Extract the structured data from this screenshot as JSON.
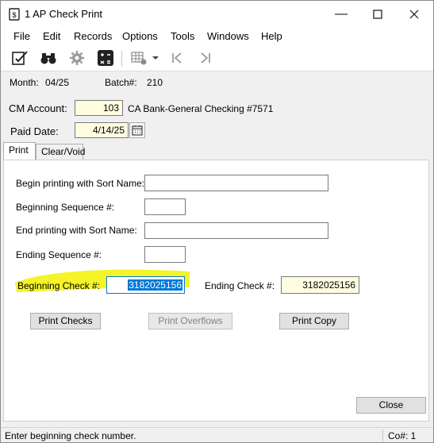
{
  "window": {
    "title": "1 AP Check Print"
  },
  "menu": [
    "File",
    "Edit",
    "Records",
    "Options",
    "Tools",
    "Windows",
    "Help"
  ],
  "toolbar": {
    "icons": [
      "edit-check-icon",
      "binoculars-icon",
      "gear-icon",
      "calculator-icon",
      "grid-settings-icon",
      "chevron-down-icon",
      "first-record-icon",
      "last-record-icon"
    ]
  },
  "header": {
    "month_label": "Month:",
    "month_value": "04/25",
    "batch_label": "Batch#:",
    "batch_value": "210"
  },
  "cm_account": {
    "label": "CM Account:",
    "value": "103",
    "description": "CA Bank-General Checking #7571"
  },
  "paid_date": {
    "label": "Paid Date:",
    "value": "4/14/25"
  },
  "tabs": [
    "Print",
    "Clear/Void"
  ],
  "form": {
    "begin_sort_label": "Begin printing with Sort Name:",
    "begin_seq_label": "Beginning Sequence #:",
    "end_sort_label": "End printing with Sort Name:",
    "end_seq_label": "Ending Sequence #:",
    "begin_check_label": "Beginning Check #:",
    "begin_check_value": "3182025156",
    "end_check_label": "Ending Check #:",
    "end_check_value": "3182025156"
  },
  "buttons": {
    "print_checks": "Print Checks",
    "print_overflows": "Print Overflows",
    "print_copy": "Print Copy",
    "close": "Close"
  },
  "status": {
    "message": "Enter beginning check number.",
    "company": "Co#: 1"
  },
  "colors": {
    "highlight": "#f2f200",
    "selection": "#0078d7",
    "field_bg": "#fffde0"
  }
}
